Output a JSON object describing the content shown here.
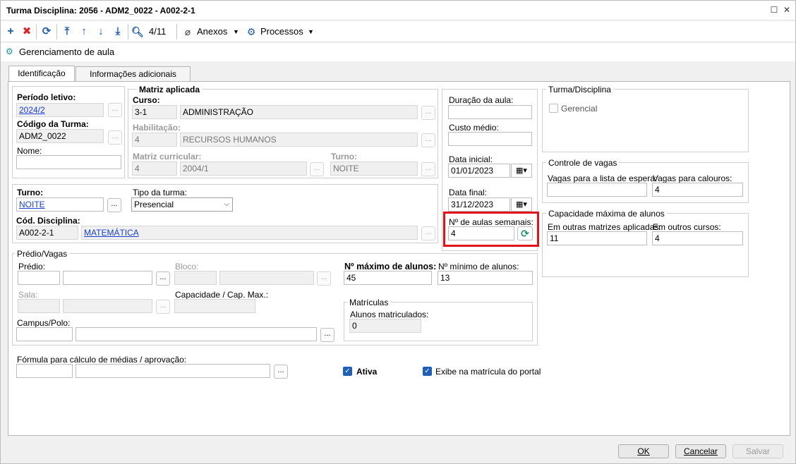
{
  "window": {
    "title": "Turma Disciplina: 2056 - ADM2_0022 - A002-2-1"
  },
  "toolbar": {
    "record_position": "4/11",
    "anexos_label": "Anexos",
    "processos_label": "Processos"
  },
  "subtitle": "Gerenciamento de aula",
  "tabs": [
    "Identificação",
    "Informações adicionais"
  ],
  "left_group": {
    "periodo_label": "Período letivo:",
    "periodo_value": "2024/2",
    "codigo_label": "Código da Turma:",
    "codigo_value": "ADM2_0022",
    "nome_label": "Nome:",
    "nome_value": ""
  },
  "matriz": {
    "title": "Matriz aplicada",
    "curso_label": "Curso:",
    "curso_code": "3-1",
    "curso_name": "ADMINISTRAÇÃO",
    "habilitacao_label": "Habilitação:",
    "habilitacao_code": "4",
    "habilitacao_name": "RECURSOS HUMANOS",
    "matriz_curricular_label": "Matriz curricular:",
    "matriz_code": "4",
    "matriz_name": "2004/1",
    "turno_label": "Turno:",
    "turno_value": "NOITE"
  },
  "turno_group": {
    "turno_label": "Turno:",
    "turno_value": "NOITE",
    "tipo_label": "Tipo da turma:",
    "tipo_value": "Presencial",
    "disciplina_label": "Cód. Disciplina:",
    "disciplina_code": "A002-2-1",
    "disciplina_name": "MATEMÁTICA"
  },
  "right_fields": {
    "duracao_label": "Duração da aula:",
    "duracao_value": "",
    "custo_label": "Custo médio:",
    "custo_value": "",
    "data_inicial_label": "Data inicial:",
    "data_inicial_value": "01/01/2023",
    "data_final_label": "Data final:",
    "data_final_value": "31/12/2023",
    "aulas_label": "Nº de aulas semanais:",
    "aulas_value": "4"
  },
  "turma_disciplina": {
    "title": "Turma/Disciplina",
    "gerencial_label": "Gerencial"
  },
  "controle_vagas": {
    "title": "Controle de vagas",
    "espera_label": "Vagas para a lista de espera:",
    "espera_value": "",
    "calouros_label": "Vagas para calouros:",
    "calouros_value": "4"
  },
  "capacidade": {
    "title": "Capacidade máxima de alunos",
    "outras_matrizes_label": "Em outras matrizes aplicadas:",
    "outras_matrizes_value": "11",
    "outros_cursos_label": "Em outros cursos:",
    "outros_cursos_value": "4"
  },
  "predio": {
    "title": "Prédio/Vagas",
    "predio_label": "Prédio:",
    "bloco_label": "Bloco:",
    "sala_label": "Sala:",
    "capacidade_label": "Capacidade / Cap. Max.:",
    "campus_label": "Campus/Polo:",
    "max_alunos_label": "Nº máximo de alunos:",
    "max_alunos_value": "45",
    "min_alunos_label": "Nº mínimo de alunos:",
    "min_alunos_value": "13",
    "matriculas_title": "Matrículas",
    "matriculados_label": "Alunos matriculados:",
    "matriculados_value": "0"
  },
  "formula": {
    "label": "Fórmula para cálculo de médias / aprovação:",
    "ativa_label": "Ativa",
    "exibe_label": "Exibe na matrícula do portal"
  },
  "footer": {
    "ok_label": "OK",
    "cancelar_label": "Cancelar",
    "salvar_label": "Salvar"
  }
}
